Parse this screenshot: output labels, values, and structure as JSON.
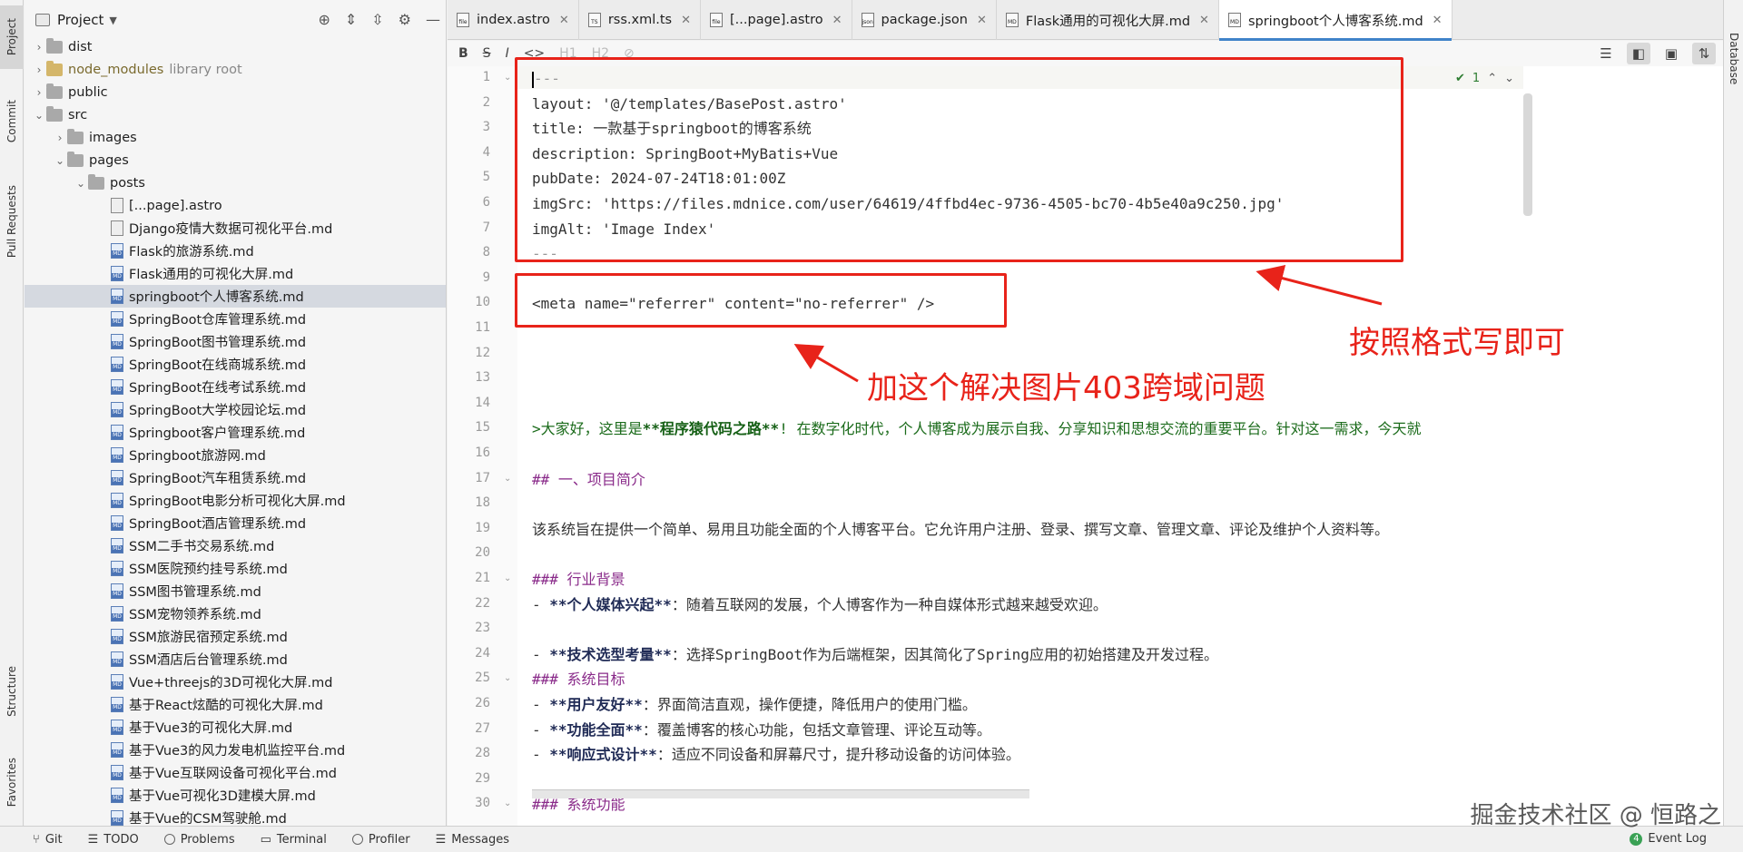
{
  "left_strip": [
    "Project",
    "Commit",
    "Pull Requests",
    "Structure",
    "Favorites"
  ],
  "right_strip": "Database",
  "project_panel": {
    "title": "Project",
    "tree": [
      {
        "label": "dist",
        "type": "folder",
        "indent": 1,
        "arrow": "›"
      },
      {
        "label": "node_modules",
        "extra": "library root",
        "type": "folder-yellow",
        "indent": 1,
        "arrow": "›"
      },
      {
        "label": "public",
        "type": "folder",
        "indent": 1,
        "arrow": "›"
      },
      {
        "label": "src",
        "type": "folder",
        "indent": 1,
        "arrow": "⌄"
      },
      {
        "label": "images",
        "type": "folder",
        "indent": 2,
        "arrow": "›"
      },
      {
        "label": "pages",
        "type": "folder",
        "indent": 2,
        "arrow": "⌄"
      },
      {
        "label": "posts",
        "type": "folder",
        "indent": 3,
        "arrow": "⌄"
      },
      {
        "label": "[...page].astro",
        "type": "file-gray",
        "indent": 4
      },
      {
        "label": "Django疫情大数据可视化平台.md",
        "type": "file-gray",
        "indent": 4
      },
      {
        "label": "Flask的旅游系统.md",
        "type": "md",
        "indent": 4
      },
      {
        "label": "Flask通用的可视化大屏.md",
        "type": "md",
        "indent": 4
      },
      {
        "label": "springboot个人博客系统.md",
        "type": "md",
        "indent": 4,
        "selected": true
      },
      {
        "label": "SpringBoot仓库管理系统.md",
        "type": "md",
        "indent": 4
      },
      {
        "label": "SpringBoot图书管理系统.md",
        "type": "md",
        "indent": 4
      },
      {
        "label": "SpringBoot在线商城系统.md",
        "type": "md",
        "indent": 4
      },
      {
        "label": "SpringBoot在线考试系统.md",
        "type": "md",
        "indent": 4
      },
      {
        "label": "SpringBoot大学校园论坛.md",
        "type": "md",
        "indent": 4
      },
      {
        "label": "Springboot客户管理系统.md",
        "type": "md",
        "indent": 4
      },
      {
        "label": "Springboot旅游网.md",
        "type": "md",
        "indent": 4
      },
      {
        "label": "SpringBoot汽车租赁系统.md",
        "type": "md",
        "indent": 4
      },
      {
        "label": "SpringBoot电影分析可视化大屏.md",
        "type": "md",
        "indent": 4
      },
      {
        "label": "SpringBoot酒店管理系统.md",
        "type": "md",
        "indent": 4
      },
      {
        "label": "SSM二手书交易系统.md",
        "type": "md",
        "indent": 4
      },
      {
        "label": "SSM医院预约挂号系统.md",
        "type": "md",
        "indent": 4
      },
      {
        "label": "SSM图书管理系统.md",
        "type": "md",
        "indent": 4
      },
      {
        "label": "SSM宠物领养系统.md",
        "type": "md",
        "indent": 4
      },
      {
        "label": "SSM旅游民宿预定系统.md",
        "type": "md",
        "indent": 4
      },
      {
        "label": "SSM酒店后台管理系统.md",
        "type": "md",
        "indent": 4
      },
      {
        "label": "Vue+threejs的3D可视化大屏.md",
        "type": "md",
        "indent": 4
      },
      {
        "label": "基于React炫酷的可视化大屏.md",
        "type": "md",
        "indent": 4
      },
      {
        "label": "基于Vue3的可视化大屏.md",
        "type": "md",
        "indent": 4
      },
      {
        "label": "基于Vue3的风力发电机监控平台.md",
        "type": "md",
        "indent": 4
      },
      {
        "label": "基于Vue互联网设备可视化平台.md",
        "type": "md",
        "indent": 4
      },
      {
        "label": "基于Vue可视化3D建模大屏.md",
        "type": "md",
        "indent": 4
      },
      {
        "label": "基于Vue的CSM驾驶舱.md",
        "type": "md",
        "indent": 4
      }
    ]
  },
  "tabs": [
    {
      "label": "index.astro",
      "icon": "file"
    },
    {
      "label": "rss.xml.ts",
      "icon": "TS"
    },
    {
      "label": "[...page].astro",
      "icon": "file"
    },
    {
      "label": "package.json",
      "icon": "json"
    },
    {
      "label": "Flask通用的可视化大屏.md",
      "icon": "MD"
    },
    {
      "label": "springboot个人博客系统.md",
      "icon": "MD",
      "active": true
    }
  ],
  "toolbar": {
    "bold": "B",
    "strike": "S",
    "italic": "I",
    "code": "<>",
    "h1": "H1",
    "h2": "H2",
    "link": "⊘"
  },
  "inspection": {
    "count": "1",
    "check": "✔"
  },
  "editor_lines": [
    {
      "n": "1",
      "segs": [
        {
          "t": "---",
          "c": "md-dim"
        }
      ]
    },
    {
      "n": "2",
      "segs": [
        {
          "t": "layout: '@/templates/BasePost.astro'",
          "c": "md-plain"
        }
      ]
    },
    {
      "n": "3",
      "segs": [
        {
          "t": "title: 一款基于springboot的博客系统",
          "c": "md-plain"
        }
      ]
    },
    {
      "n": "4",
      "segs": [
        {
          "t": "description: SpringBoot+MyBatis+Vue",
          "c": "md-plain"
        }
      ]
    },
    {
      "n": "5",
      "segs": [
        {
          "t": "pubDate: 2024-07-24T18:01:00Z",
          "c": "md-plain"
        }
      ]
    },
    {
      "n": "6",
      "segs": [
        {
          "t": "imgSrc: 'https://files.mdnice.com/user/64619/4ffbd4ec-9736-4505-bc70-4b5e40a9c250.jpg'",
          "c": "md-plain"
        }
      ]
    },
    {
      "n": "7",
      "segs": [
        {
          "t": "imgAlt: 'Image Index'",
          "c": "md-plain"
        }
      ]
    },
    {
      "n": "8",
      "segs": [
        {
          "t": "---",
          "c": "md-dim"
        }
      ]
    },
    {
      "n": "9",
      "segs": []
    },
    {
      "n": "10",
      "segs": [
        {
          "t": "<meta name=\"referrer\" content=\"no-referrer\" />",
          "c": "md-plain"
        }
      ]
    },
    {
      "n": "11",
      "segs": []
    },
    {
      "n": "12",
      "segs": []
    },
    {
      "n": "13",
      "segs": []
    },
    {
      "n": "14",
      "segs": []
    },
    {
      "n": "15",
      "segs": [
        {
          "t": ">大家好，这里是",
          "c": "md-quote"
        },
        {
          "t": "**程序猿代码之路**",
          "c": "md-quote md-boldq"
        },
        {
          "t": "! 在数字化时代，个人博客成为展示自我、分享知识和思想交流的重要平台。针对这一需求，今天就",
          "c": "md-quote"
        }
      ]
    },
    {
      "n": "16",
      "segs": []
    },
    {
      "n": "17",
      "segs": [
        {
          "t": "## 一、项目简介",
          "c": "md-head"
        }
      ]
    },
    {
      "n": "18",
      "segs": []
    },
    {
      "n": "19",
      "segs": [
        {
          "t": "该系统旨在提供一个简单、易用且功能全面的个人博客平台。它允许用户注册、登录、撰写文章、管理文章、评论及维护个人资料等。",
          "c": "md-plain"
        }
      ]
    },
    {
      "n": "20",
      "segs": []
    },
    {
      "n": "21",
      "segs": [
        {
          "t": "### 行业背景",
          "c": "md-head"
        }
      ]
    },
    {
      "n": "22",
      "segs": [
        {
          "t": "- ",
          "c": "md-plain"
        },
        {
          "t": "**个人媒体兴起**",
          "c": "md-bold"
        },
        {
          "t": "：随着互联网的发展，个人博客作为一种自媒体形式越来越受欢迎。",
          "c": "md-plain"
        }
      ]
    },
    {
      "n": "23",
      "segs": []
    },
    {
      "n": "24",
      "segs": [
        {
          "t": "- ",
          "c": "md-plain"
        },
        {
          "t": "**技术选型考量**",
          "c": "md-bold"
        },
        {
          "t": "：选择SpringBoot作为后端框架，因其简化了Spring应用的初始搭建及开发过程。",
          "c": "md-plain"
        }
      ]
    },
    {
      "n": "25",
      "segs": [
        {
          "t": "### 系统目标",
          "c": "md-head"
        }
      ]
    },
    {
      "n": "26",
      "segs": [
        {
          "t": "- ",
          "c": "md-plain"
        },
        {
          "t": "**用户友好**",
          "c": "md-bold"
        },
        {
          "t": "：界面简洁直观，操作便捷，降低用户的使用门槛。",
          "c": "md-plain"
        }
      ]
    },
    {
      "n": "27",
      "segs": [
        {
          "t": "- ",
          "c": "md-plain"
        },
        {
          "t": "**功能全面**",
          "c": "md-bold"
        },
        {
          "t": "：覆盖博客的核心功能，包括文章管理、评论互动等。",
          "c": "md-plain"
        }
      ]
    },
    {
      "n": "28",
      "segs": [
        {
          "t": "- ",
          "c": "md-plain"
        },
        {
          "t": "**响应式设计**",
          "c": "md-bold"
        },
        {
          "t": "：适应不同设备和屏幕尺寸，提升移动设备的访问体验。",
          "c": "md-plain"
        }
      ]
    },
    {
      "n": "29",
      "segs": []
    },
    {
      "n": "30",
      "segs": [
        {
          "t": "### 系统功能",
          "c": "md-head"
        }
      ]
    }
  ],
  "annotations": {
    "format_note": "按照格式写即可",
    "fix_note": "加这个解决图片403跨域问题",
    "color": "#e8231a"
  },
  "statusbar": {
    "items": [
      "Git",
      "TODO",
      "Problems",
      "Terminal",
      "Profiler",
      "Messages"
    ],
    "event_count": "4",
    "event_log": "Event Log"
  },
  "watermark": "掘金技术社区 @ 恒路之"
}
